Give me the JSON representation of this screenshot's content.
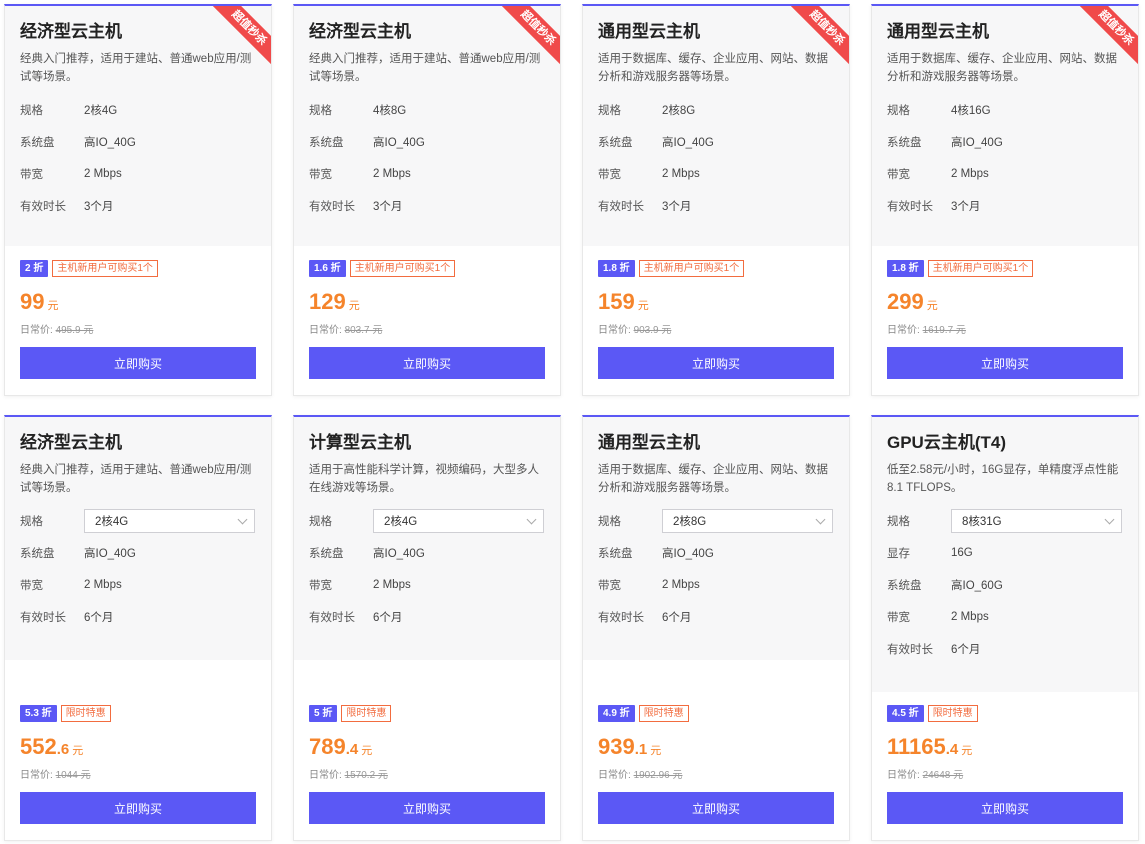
{
  "labels": {
    "spec": "规格",
    "disk": "系统盘",
    "bandwidth": "带宽",
    "duration": "有效时长",
    "gpu_mem": "显存",
    "daily_price": "日常价:",
    "unit": "元",
    "buy": "立即购买",
    "ribbon": "超值秒杀"
  },
  "row1": [
    {
      "title": "经济型云主机",
      "desc": "经典入门推荐，适用于建站、普通web应用/测试等场景。",
      "spec": "2核4G",
      "disk": "高IO_40G",
      "bandwidth": "2 Mbps",
      "duration": "3个月",
      "discount": "2 折",
      "promo": "主机新用户可购买1个",
      "price_int": "99",
      "price_dec": "",
      "orig": "495.9 元"
    },
    {
      "title": "经济型云主机",
      "desc": "经典入门推荐，适用于建站、普通web应用/测试等场景。",
      "spec": "4核8G",
      "disk": "高IO_40G",
      "bandwidth": "2 Mbps",
      "duration": "3个月",
      "discount": "1.6 折",
      "promo": "主机新用户可购买1个",
      "price_int": "129",
      "price_dec": "",
      "orig": "803.7 元"
    },
    {
      "title": "通用型云主机",
      "desc": "适用于数据库、缓存、企业应用、网站、数据分析和游戏服务器等场景。",
      "spec": "2核8G",
      "disk": "高IO_40G",
      "bandwidth": "2 Mbps",
      "duration": "3个月",
      "discount": "1.8 折",
      "promo": "主机新用户可购买1个",
      "price_int": "159",
      "price_dec": "",
      "orig": "903.9 元"
    },
    {
      "title": "通用型云主机",
      "desc": "适用于数据库、缓存、企业应用、网站、数据分析和游戏服务器等场景。",
      "spec": "4核16G",
      "disk": "高IO_40G",
      "bandwidth": "2 Mbps",
      "duration": "3个月",
      "discount": "1.8 折",
      "promo": "主机新用户可购买1个",
      "price_int": "299",
      "price_dec": "",
      "orig": "1619.7 元"
    }
  ],
  "row2": [
    {
      "title": "经济型云主机",
      "desc": "经典入门推荐，适用于建站、普通web应用/测试等场景。",
      "spec": "2核4G",
      "disk": "高IO_40G",
      "bandwidth": "2 Mbps",
      "duration": "6个月",
      "discount": "5.3 折",
      "promo": "限时特惠",
      "price_int": "552",
      "price_dec": ".6",
      "orig": "1044 元"
    },
    {
      "title": "计算型云主机",
      "desc": "适用于高性能科学计算，视频编码，大型多人在线游戏等场景。",
      "spec": "2核4G",
      "disk": "高IO_40G",
      "bandwidth": "2 Mbps",
      "duration": "6个月",
      "discount": "5 折",
      "promo": "限时特惠",
      "price_int": "789",
      "price_dec": ".4",
      "orig": "1570.2 元"
    },
    {
      "title": "通用型云主机",
      "desc": "适用于数据库、缓存、企业应用、网站、数据分析和游戏服务器等场景。",
      "spec": "2核8G",
      "disk": "高IO_40G",
      "bandwidth": "2 Mbps",
      "duration": "6个月",
      "discount": "4.9 折",
      "promo": "限时特惠",
      "price_int": "939",
      "price_dec": ".1",
      "orig": "1902.96 元"
    },
    {
      "title": "GPU云主机(T4)",
      "desc": "低至2.58元/小时，16G显存，单精度浮点性能8.1 TFLOPS。",
      "spec": "8核31G",
      "gpu_mem": "16G",
      "disk": "高IO_60G",
      "bandwidth": "2 Mbps",
      "duration": "6个月",
      "discount": "4.5 折",
      "promo": "限时特惠",
      "price_int": "11165",
      "price_dec": ".4",
      "orig": "24648 元"
    }
  ],
  "colors": {
    "accent": "#5b58f5",
    "price": "#f5842b",
    "promo": "#f26c3f",
    "ribbon": "#f04a4a"
  }
}
